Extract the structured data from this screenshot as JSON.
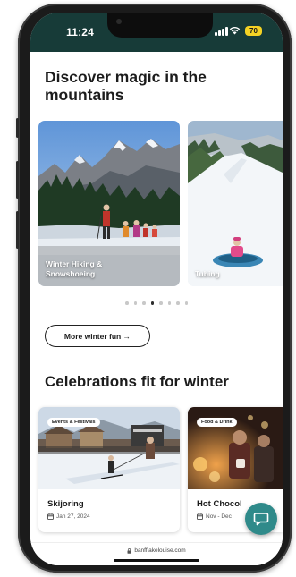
{
  "status": {
    "time": "11:24",
    "battery": "70"
  },
  "section1": {
    "title": "Discover magic in the mountains",
    "cards": [
      {
        "label": "Winter Hiking & Snowshoeing"
      },
      {
        "label": "Tubing"
      }
    ],
    "carousel": {
      "total": 8,
      "active_index": 3
    }
  },
  "more_button": {
    "label": "More winter fun →"
  },
  "section2": {
    "title": "Celebrations fit for winter",
    "events": [
      {
        "tag": "Events & Festivals",
        "title": "Skijoring",
        "date": "Jan 27, 2024"
      },
      {
        "tag": "Food & Drink",
        "title": "Hot Chocol",
        "date": "Nov - Dec"
      }
    ]
  },
  "url_bar": {
    "url": "banfflakelouise.com"
  },
  "icons": [
    "signal-icon",
    "wifi-icon",
    "battery-icon",
    "calendar-icon",
    "chat-icon",
    "lock-icon"
  ],
  "colors": {
    "header": "#173b38",
    "battery": "#f4d224",
    "chat_fab": "#2f8a8a"
  }
}
